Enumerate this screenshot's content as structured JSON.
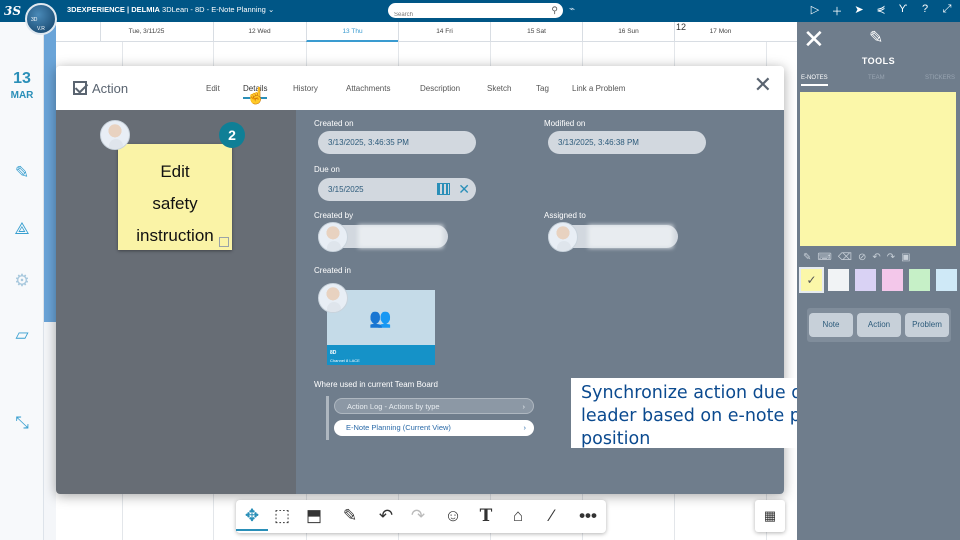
{
  "app": {
    "brand": "3DEXPERIENCE | DELMIA",
    "product": "3DLean - 8D - E-Note Planning",
    "search_placeholder": "Search",
    "compass_label": "V.R"
  },
  "calendar": {
    "day_number": "13",
    "month": "MAR",
    "week_number": "12",
    "columns": [
      "Tue, 3/11/25",
      "12 Wed",
      "13 Thu",
      "14 Fri",
      "15 Sat",
      "16 Sun",
      "17 Mon"
    ]
  },
  "dialog": {
    "title": "Action",
    "tabs": [
      "Edit",
      "Details",
      "History",
      "Attachments",
      "Description",
      "Sketch",
      "Tag",
      "Link a Problem"
    ],
    "active_tab": "Details",
    "note": {
      "text_line1": "Edit",
      "text_line2": "safety",
      "text_line3": "instruction",
      "badge": "2"
    },
    "fields": {
      "created_on_label": "Created on",
      "created_on_value": "3/13/2025, 3:46:35 PM",
      "modified_on_label": "Modified on",
      "modified_on_value": "3/13/2025, 3:46:38 PM",
      "due_on_label": "Due on",
      "due_on_value": "3/15/2025",
      "created_by_label": "Created by",
      "assigned_to_label": "Assigned to",
      "created_in_label": "Created in",
      "created_in_card_title": "8D",
      "created_in_card_sub": "Channel 8 LACE"
    },
    "where_used": {
      "label": "Where used in current Team Board",
      "items": [
        "Action Log - Actions by type",
        "E-Note Planning (Current View)"
      ]
    }
  },
  "caption": {
    "line1": "Synchronize action due dates and",
    "line2": "leader based on e-note planning",
    "line3": "position"
  },
  "tools": {
    "title": "TOOLS",
    "tabs": [
      "E-NOTES",
      "TEAM",
      "STICKERS"
    ],
    "active_tab": "E-NOTES",
    "buttons": [
      "Note",
      "Action",
      "Problem"
    ],
    "swatch_colors": [
      "#fbf7a9",
      "#f1f3f5",
      "#d9d2f4",
      "#f3c7ea",
      "#c6f0c7",
      "#cfe9f7"
    ]
  },
  "colors": {
    "top_bar": "#005686",
    "accent": "#2a8fb8",
    "caption_text": "#0b4a8f"
  }
}
